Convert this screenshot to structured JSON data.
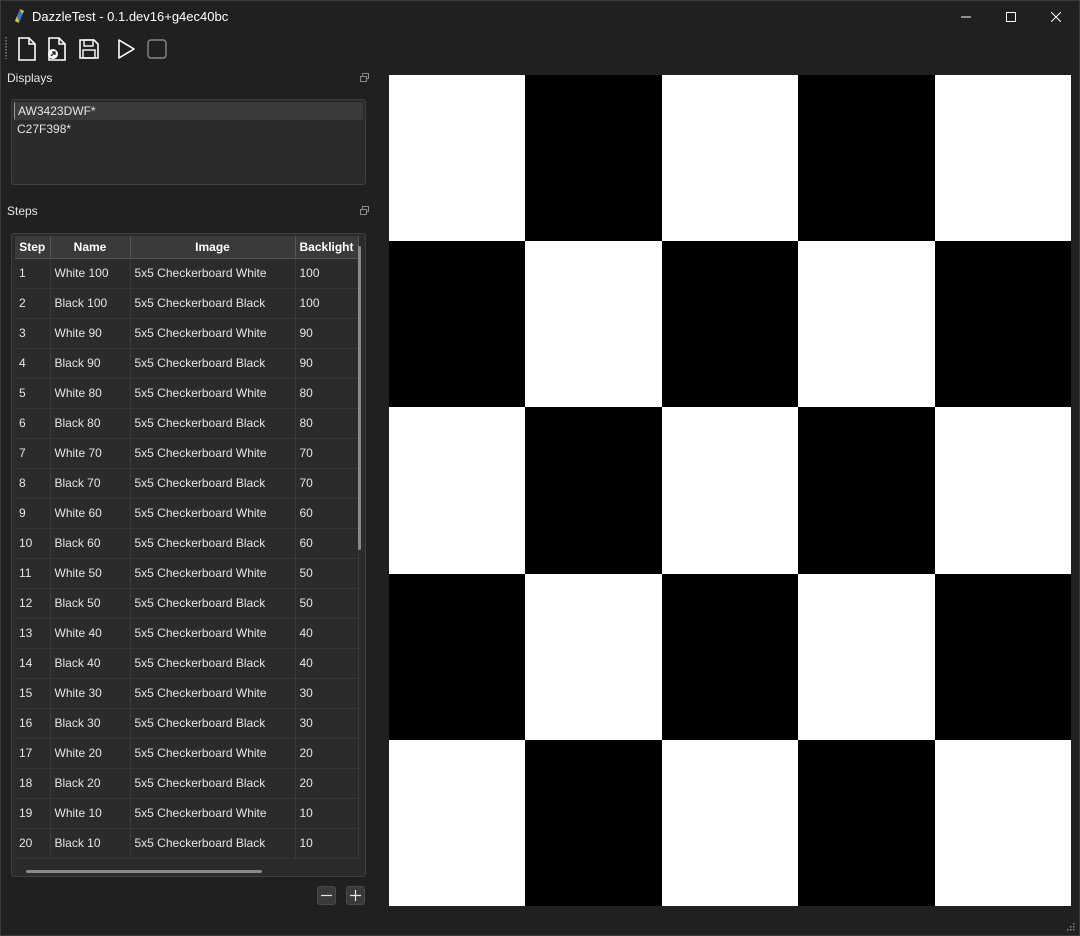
{
  "window": {
    "title": "DazzleTest - 0.1.dev16+g4ec40bc"
  },
  "toolbar": {
    "icons": [
      "new-file-icon",
      "open-file-icon",
      "save-icon",
      "play-icon",
      "stop-icon"
    ]
  },
  "displays": {
    "title": "Displays",
    "items": [
      "AW3423DWF*",
      "C27F398*"
    ],
    "selected_index": 0
  },
  "steps": {
    "title": "Steps",
    "columns": [
      "Step",
      "Name",
      "Image",
      "Backlight"
    ],
    "rows": [
      [
        "1",
        "White 100",
        "5x5 Checkerboard White",
        "100"
      ],
      [
        "2",
        "Black 100",
        "5x5 Checkerboard Black",
        "100"
      ],
      [
        "3",
        "White 90",
        "5x5 Checkerboard White",
        "90"
      ],
      [
        "4",
        "Black 90",
        "5x5 Checkerboard Black",
        "90"
      ],
      [
        "5",
        "White 80",
        "5x5 Checkerboard White",
        "80"
      ],
      [
        "6",
        "Black 80",
        "5x5 Checkerboard Black",
        "80"
      ],
      [
        "7",
        "White 70",
        "5x5 Checkerboard White",
        "70"
      ],
      [
        "8",
        "Black 70",
        "5x5 Checkerboard Black",
        "70"
      ],
      [
        "9",
        "White 60",
        "5x5 Checkerboard White",
        "60"
      ],
      [
        "10",
        "Black 60",
        "5x5 Checkerboard Black",
        "60"
      ],
      [
        "11",
        "White 50",
        "5x5 Checkerboard White",
        "50"
      ],
      [
        "12",
        "Black 50",
        "5x5 Checkerboard Black",
        "50"
      ],
      [
        "13",
        "White 40",
        "5x5 Checkerboard White",
        "40"
      ],
      [
        "14",
        "Black 40",
        "5x5 Checkerboard Black",
        "40"
      ],
      [
        "15",
        "White 30",
        "5x5 Checkerboard White",
        "30"
      ],
      [
        "16",
        "Black 30",
        "5x5 Checkerboard Black",
        "30"
      ],
      [
        "17",
        "White 20",
        "5x5 Checkerboard White",
        "20"
      ],
      [
        "18",
        "Black 20",
        "5x5 Checkerboard Black",
        "20"
      ],
      [
        "19",
        "White 10",
        "5x5 Checkerboard White",
        "10"
      ],
      [
        "20",
        "Black 10",
        "5x5 Checkerboard Black",
        "10"
      ]
    ]
  },
  "preview": {
    "grid": 5,
    "first_cell": "white",
    "colors": {
      "light": "#ffffff",
      "dark": "#000000"
    }
  },
  "theme": {
    "background": "#202020",
    "panel": "#2b2b2b",
    "header": "#3a3a3a",
    "text": "#e6e6e6"
  }
}
